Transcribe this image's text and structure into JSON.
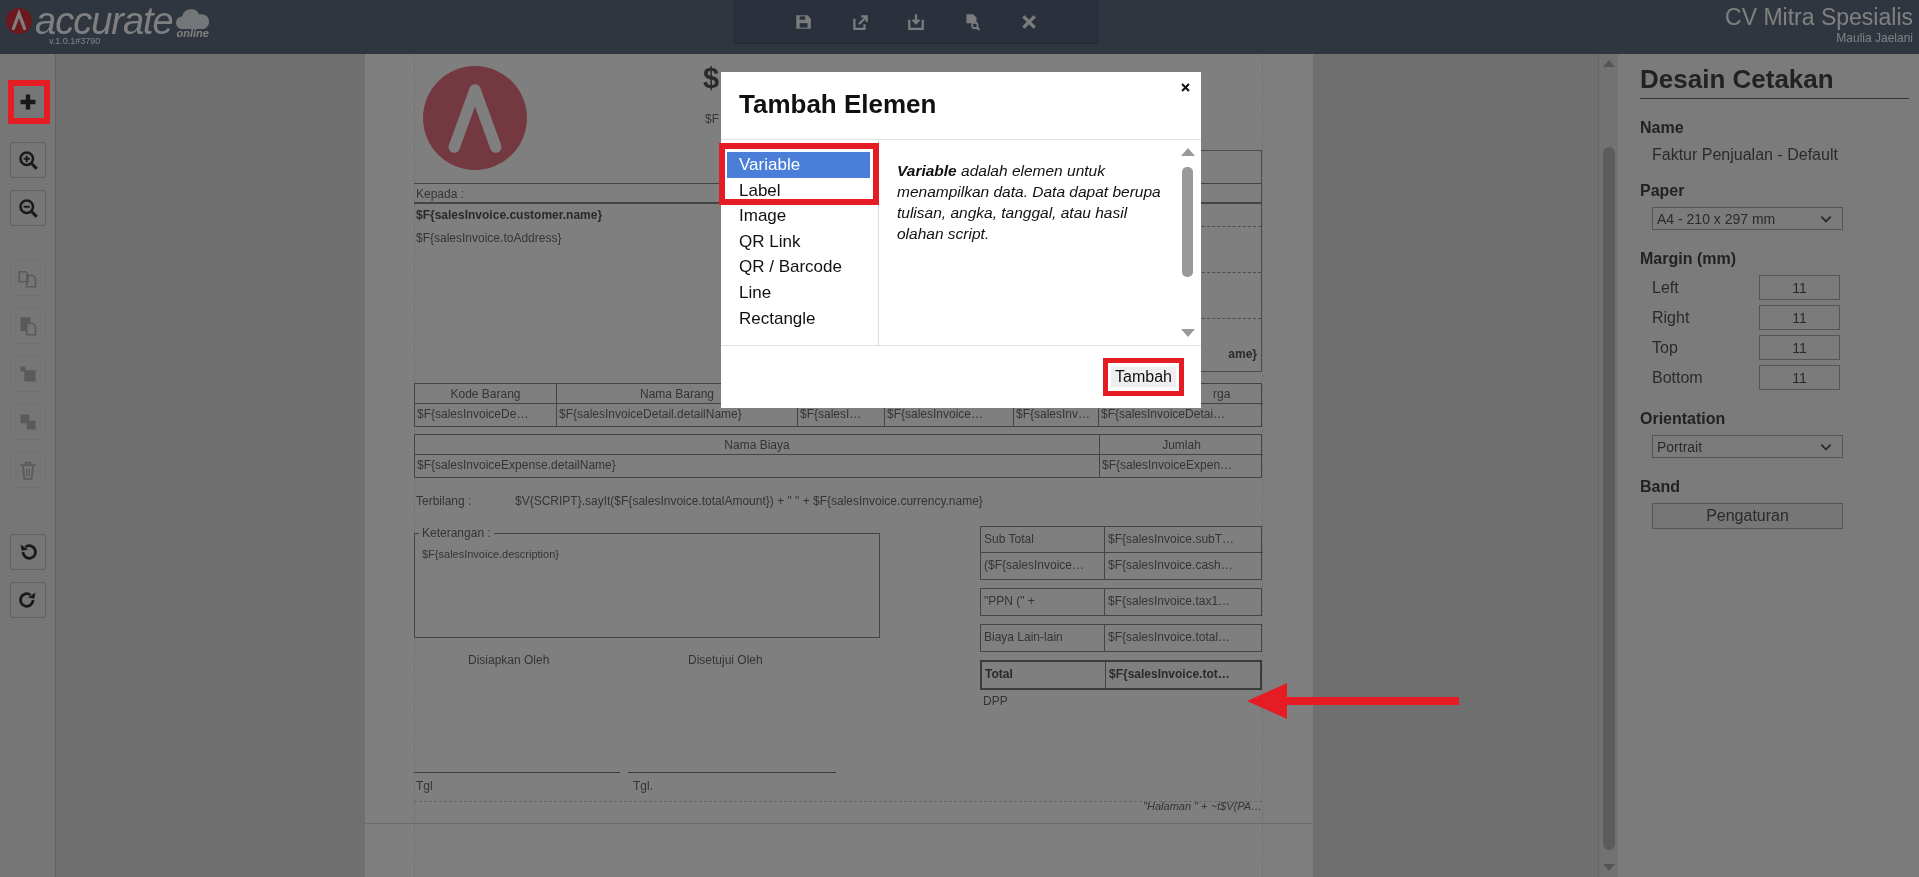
{
  "header": {
    "logo": "accurate",
    "logo_suffix": "online",
    "version": "v.1.0.1#3790",
    "company": "CV Mitra Spesialis",
    "user": "Maulia Jaelani",
    "actions": [
      {
        "kind": "save"
      },
      {
        "kind": "export"
      },
      {
        "kind": "import"
      },
      {
        "kind": "preview"
      },
      {
        "kind": "close"
      }
    ]
  },
  "tools": [
    {
      "kind": "add",
      "disabled": false
    },
    {
      "kind": "zoom-in",
      "disabled": false
    },
    {
      "kind": "zoom-out",
      "disabled": false
    },
    {
      "kind": "copy",
      "disabled": true
    },
    {
      "kind": "paste",
      "disabled": true
    },
    {
      "kind": "send-back",
      "disabled": true
    },
    {
      "kind": "bring-front",
      "disabled": true
    },
    {
      "kind": "delete",
      "disabled": true
    },
    {
      "kind": "undo",
      "disabled": false
    },
    {
      "kind": "redo",
      "disabled": false
    }
  ],
  "document": {
    "title": "$",
    "subtitle": "$F",
    "to_label": "Kepada :",
    "customer_name": "$F{salesInvoice.customer.name}",
    "address": "$F{salesInvoice.toAddress}",
    "box_text": "ame}",
    "items_table": {
      "headers": [
        "Kode Barang",
        "Nama Barang"
      ],
      "column_6_header": "rga",
      "row": [
        "$F{salesInvoiceDe…",
        "$F{salesInvoiceDetail.detailName}",
        "$F{salesI…",
        "$F{salesInvoice…",
        "$F{salesInv…",
        "$F{salesInvoiceDetai…"
      ]
    },
    "expense_table": {
      "headers": [
        "Nama Biaya",
        "Jumlah"
      ],
      "row": [
        "$F{salesInvoiceExpense.detailName}",
        "$F{salesInvoiceExpen…"
      ]
    },
    "amount_words": {
      "label": "Terbilang :",
      "formula": "$V{SCRIPT}.sayIt($F{salesInvoice.totalAmount}) + \" \" + $F{salesInvoice.currency.name}"
    },
    "notes": {
      "legend": "Keterangan :",
      "text": "$F{salesInvoice.description}"
    },
    "totals": [
      [
        {
          "label": "Sub Total",
          "value": "$F{salesInvoice.subT…",
          "bold": false
        },
        {
          "label": "($F{salesInvoice…",
          "value": "$F{salesInvoice.cash…",
          "bold": false
        }
      ],
      [
        {
          "label": "\"PPN (\" +",
          "value": "$F{salesInvoice.tax1…",
          "bold": false
        }
      ],
      [
        {
          "label": "Biaya Lain-lain",
          "value": "$F{salesInvoice.total…",
          "bold": false
        }
      ],
      [
        {
          "label": "Total",
          "value": "$F{salesInvoice.tot…",
          "bold": true
        }
      ]
    ],
    "signatures": [
      {
        "role": "Disiapkan Oleh",
        "date_label": "Tgl"
      },
      {
        "role": "Disetujui Oleh",
        "date_label": "Tgl."
      }
    ],
    "dpp": "DPP",
    "footer": "\"Halaman \" +  ~t$V{PA…"
  },
  "properties": {
    "title": "Desain Cetakan",
    "name_label": "Name",
    "name_value": "Faktur Penjualan - Default",
    "paper_label": "Paper",
    "paper_value": "A4 - 210 x 297 mm",
    "margin_label": "Margin (mm)",
    "margins": [
      {
        "label": "Left",
        "value": "11"
      },
      {
        "label": "Right",
        "value": "11"
      },
      {
        "label": "Top",
        "value": "11"
      },
      {
        "label": "Bottom",
        "value": "11"
      }
    ],
    "orientation_label": "Orientation",
    "orientation_value": "Portrait",
    "band_label": "Band",
    "band_button": "Pengaturan"
  },
  "dialog": {
    "title": "Tambah Elemen",
    "items": [
      {
        "label": "Variable",
        "selected": true
      },
      {
        "label": "Label",
        "selected": false
      },
      {
        "label": "Image",
        "selected": false
      },
      {
        "label": "QR Link",
        "selected": false
      },
      {
        "label": "QR / Barcode",
        "selected": false
      },
      {
        "label": "Line",
        "selected": false
      },
      {
        "label": "Rectangle",
        "selected": false
      }
    ],
    "description": "**Variable** adalah elemen untuk menampilkan data. Data dapat berupa tulisan, angka, tanggal, atau hasil olahan script.",
    "button": "Tambah"
  }
}
